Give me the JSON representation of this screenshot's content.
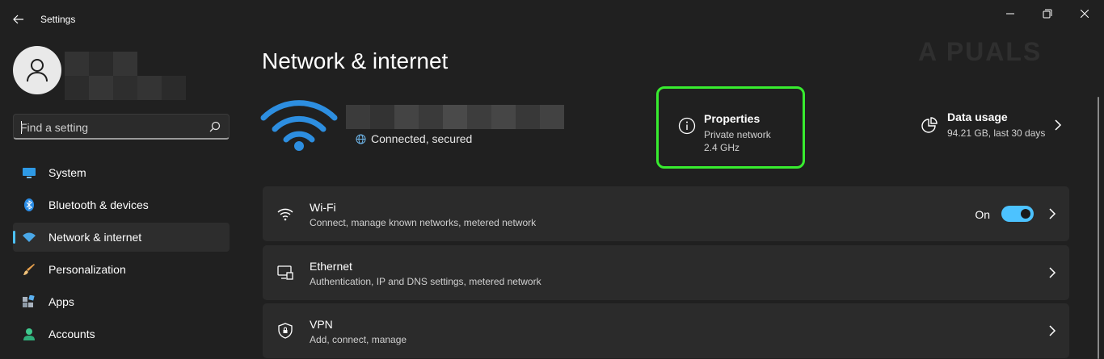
{
  "app": {
    "title": "Settings"
  },
  "watermark": "A  PUALS",
  "search": {
    "placeholder": "Find a setting",
    "value": ""
  },
  "sidebar": {
    "items": [
      {
        "label": "System",
        "icon": "monitor-icon",
        "selected": false
      },
      {
        "label": "Bluetooth & devices",
        "icon": "bluetooth-icon",
        "selected": false
      },
      {
        "label": "Network & internet",
        "icon": "wifi-icon",
        "selected": true
      },
      {
        "label": "Personalization",
        "icon": "brush-icon",
        "selected": false
      },
      {
        "label": "Apps",
        "icon": "apps-icon",
        "selected": false
      },
      {
        "label": "Accounts",
        "icon": "person-icon",
        "selected": false
      }
    ]
  },
  "main": {
    "title": "Network & internet",
    "status": "Connected, secured",
    "properties": {
      "title": "Properties",
      "network": "Private network",
      "band": "2.4 GHz"
    },
    "data_usage": {
      "title": "Data usage",
      "detail": "94.21 GB, last 30 days"
    },
    "rows": [
      {
        "title": "Wi-Fi",
        "subtitle": "Connect, manage known networks, metered network",
        "icon": "wifi-icon",
        "toggle_label": "On"
      },
      {
        "title": "Ethernet",
        "subtitle": "Authentication, IP and DNS settings, metered network",
        "icon": "ethernet-icon"
      },
      {
        "title": "VPN",
        "subtitle": "Add, connect, manage",
        "icon": "shield-icon"
      }
    ]
  },
  "colors": {
    "accent": "#4cc2ff",
    "highlight": "#38ec2f",
    "background": "#202020",
    "card": "#2b2b2b"
  }
}
